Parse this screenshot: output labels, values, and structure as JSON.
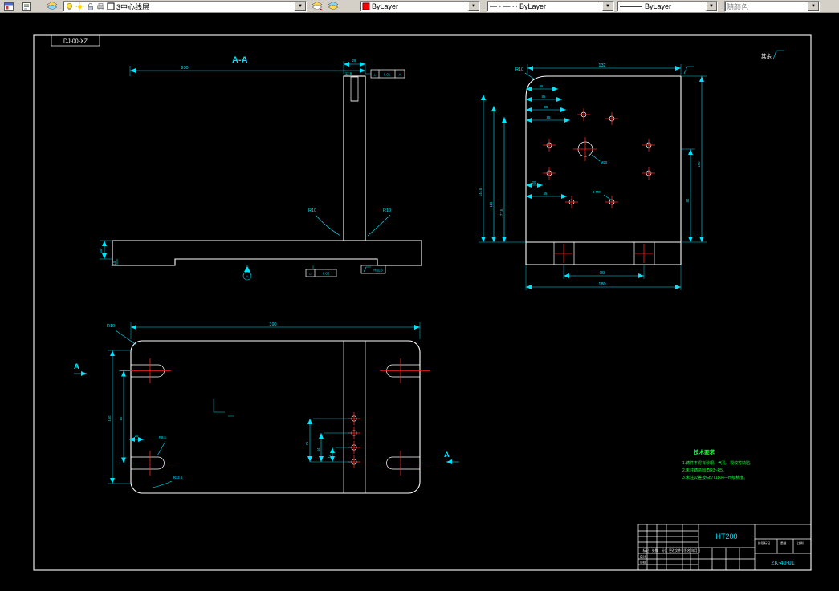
{
  "toolbar": {
    "layer_combo": {
      "value": "3中心线层"
    },
    "color_combo": {
      "value": "ByLayer",
      "swatch": "#ff0000"
    },
    "linetype_combo": {
      "value": "ByLayer"
    },
    "lineweight_combo": {
      "value": "ByLayer"
    },
    "plotstyle_combo": {
      "value": "随颜色"
    }
  },
  "colors": {
    "dimension": "#00e5ff",
    "outline": "#ffffff",
    "centerline": "#ff2222",
    "notes": "#19ff38"
  },
  "frame": {
    "corner_label": "DJ-00-XZ"
  },
  "surface_note": {
    "text": "其余"
  },
  "section_view": {
    "title": "A-A",
    "dim_width": "930",
    "dim_col": "28",
    "dim_col_inner": "12.6",
    "tol_sym": "⊥",
    "tol_val": "0.01",
    "tol_datum": "A",
    "fillet_left": "R10",
    "fillet_right": "R10",
    "dim_base_h": "20",
    "dim_pad_h": "15",
    "flat_sym": "▱",
    "flat_val": "0.05",
    "finish_bottom": "Ra1.6",
    "datum": "A"
  },
  "front_view": {
    "fillet": "R10",
    "dim_width": "132",
    "dims_left_ladder": [
      "65",
      "85",
      "85",
      "85"
    ],
    "dim_20": "20",
    "dim_65": "65",
    "thread_label": "M20",
    "holes_label": "8-M8",
    "dims_left_vert": [
      "144.5",
      "110",
      "77.5"
    ],
    "dim_right_160": "160",
    "dim_right_80": "80",
    "dim_feet": "80",
    "dim_total": "180"
  },
  "plan_view": {
    "dim_width": "390",
    "fillet": "R10",
    "section_mark": "A",
    "dim_160": "160",
    "dim_80": "80",
    "dim_20": "20",
    "slot_r": "R8.5",
    "corner_r": "R12.5",
    "dims_holes": [
      "76",
      "44",
      "14"
    ]
  },
  "notes": {
    "title": "技术要求",
    "lines": [
      "1.铸件不得有砂眼、气孔、裂纹等缺陷。",
      "2.未注铸造圆角R3~R5。",
      "3.未注公差按GB/T1804—m级精度。"
    ]
  },
  "title_block": {
    "material": "HT200",
    "drawing_no": "ZK-40-01",
    "row_labels": [
      "标记",
      "处数",
      "分区",
      "更改文件号",
      "签名",
      "年月日"
    ],
    "col_labels": [
      "设计",
      "审核"
    ],
    "right_labels": [
      "阶段标记",
      "重量",
      "比例"
    ]
  }
}
